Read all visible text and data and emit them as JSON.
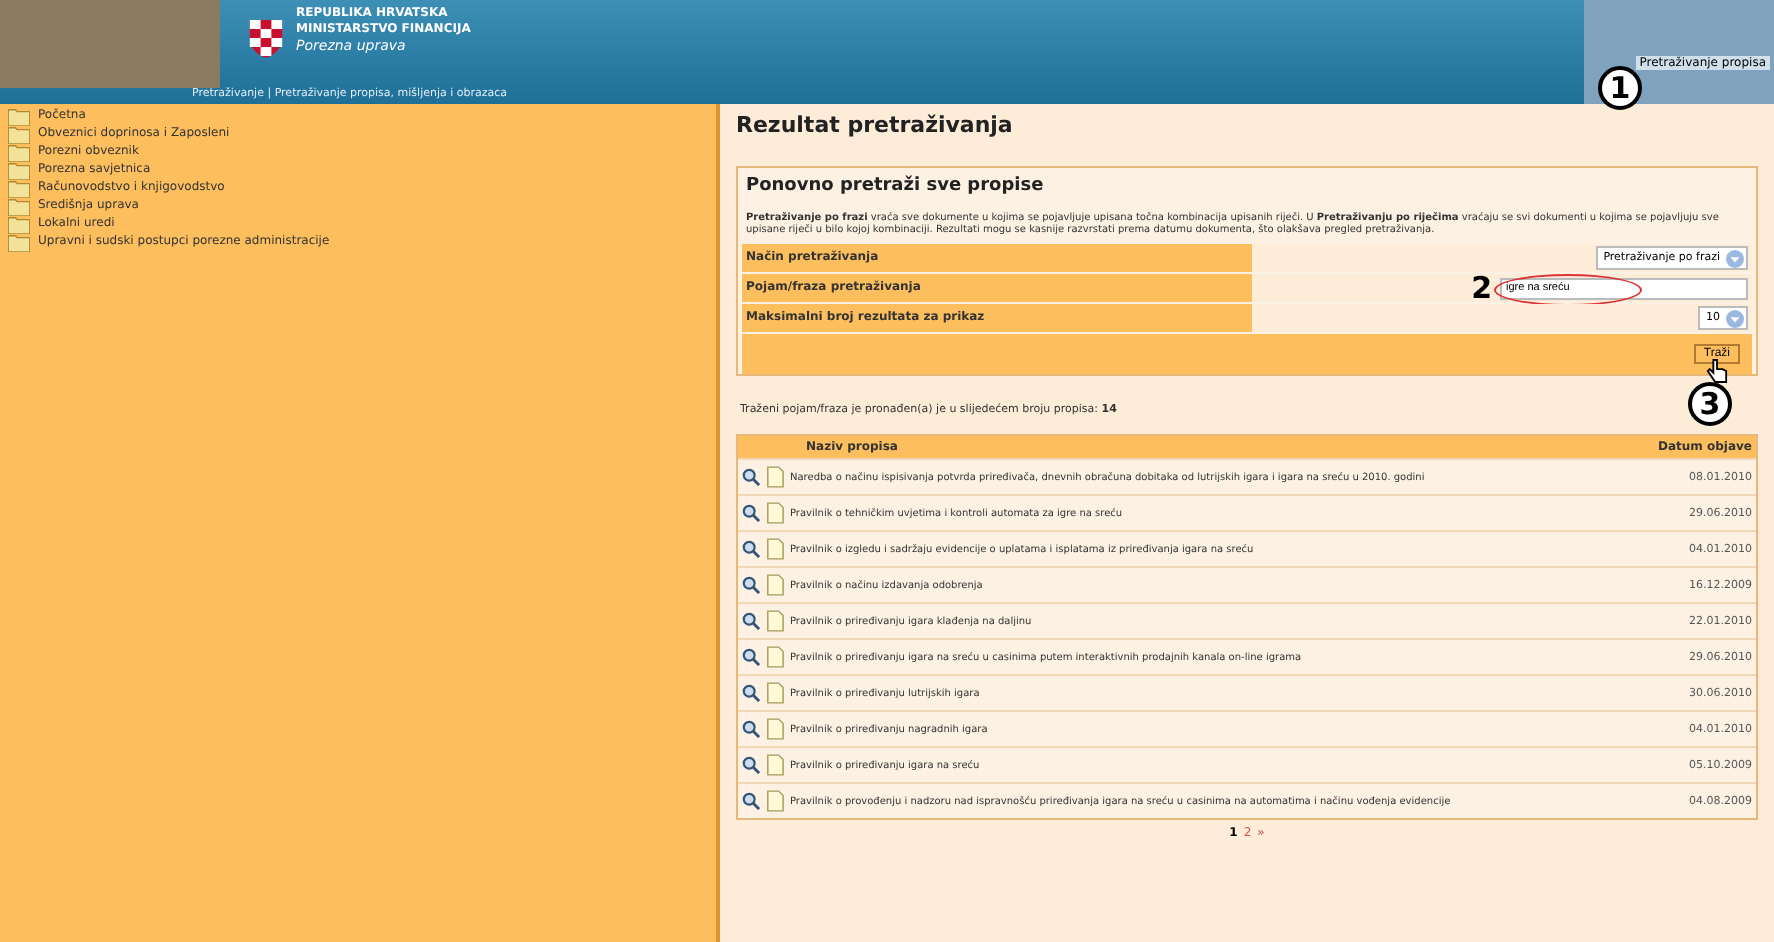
{
  "header": {
    "country": "REPUBLIKA HRVATSKA",
    "ministry": "MINISTARSTVO FINANCIJA",
    "agency": "Porezna uprava",
    "breadcrumb": "Pretraživanje | Pretraživanje propisa, mišljenja i obrazaca",
    "top_link": "Pretraživanje propisa"
  },
  "annotations": [
    "1",
    "2",
    "3"
  ],
  "sidebar": {
    "items": [
      {
        "label": "Početna"
      },
      {
        "label": "Obveznici doprinosa i Zaposleni"
      },
      {
        "label": "Porezni obveznik"
      },
      {
        "label": "Porezna savjetnica"
      },
      {
        "label": "Računovodstvo i knjigovodstvo"
      },
      {
        "label": "Središnja uprava"
      },
      {
        "label": "Lokalni uredi"
      },
      {
        "label": "Upravni i sudski postupci porezne administracije"
      }
    ]
  },
  "main": {
    "title": "Rezultat pretraživanja",
    "search_box": {
      "title": "Ponovno pretraži sve propise",
      "description": "**Pretraživanje po frazi** vraća sve dokumente u kojima se pojavljuje upisana točna kombinacija upisanih riječi. U **Pretraživanju po riječima** vraćaju se svi dokumenti u kojima se pojavljuju sve upisane riječi u bilo kojoj kombinaciji. Rezultati mogu se kasnije razvrstati prema datumu dokumenta, što olakšava pregled pretraživanja.",
      "fields": [
        {
          "kind": "select",
          "label": "Način pretraživanja",
          "value": "Pretraživanje po frazi"
        },
        {
          "kind": "input",
          "label": "Pojam/fraza pretraživanja",
          "value": "igre na sreću"
        },
        {
          "kind": "select",
          "label": "Maksimalni broj rezultata za prikaz",
          "value": "10"
        }
      ],
      "button": "Traži"
    },
    "result_count": "Traženi pojam/fraza je pronađen(a) je u slijedećem broju propisa: **14**",
    "table": {
      "columns": [
        "Naziv propisa",
        "Datum objave"
      ],
      "rows": [
        {
          "name": "Naredba o načinu ispisivanja potvrda priređivača, dnevnih obračuna dobitaka od lutrijskih igara i igara na sreću u 2010. godini",
          "date": "08.01.2010"
        },
        {
          "name": "Pravilnik o tehničkim uvjetima i kontroli automata za igre na sreću",
          "date": "29.06.2010"
        },
        {
          "name": "Pravilnik o izgledu i sadržaju evidencije o uplatama i isplatama iz priređivanja igara na sreću",
          "date": "04.01.2010"
        },
        {
          "name": "Pravilnik o načinu izdavanja odobrenja",
          "date": "16.12.2009"
        },
        {
          "name": "Pravilnik o priređivanju igara klađenja na daljinu",
          "date": "22.01.2010"
        },
        {
          "name": "Pravilnik o priređivanju igara na sreću u casinima putem interaktivnih prodajnih kanala on-line igrama",
          "date": "29.06.2010"
        },
        {
          "name": "Pravilnik o priređivanju lutrijskih igara",
          "date": "30.06.2010"
        },
        {
          "name": "Pravilnik o priređivanju nagradnih igara",
          "date": "04.01.2010"
        },
        {
          "name": "Pravilnik o priređivanju igara na sreću",
          "date": "05.10.2009"
        },
        {
          "name": "Pravilnik o provođenju i nadzoru nad ispravnošću priređivanja igara na sreću u casinima na automatima i načinu vođenja evidencije",
          "date": "04.08.2009"
        }
      ]
    },
    "pagination": [
      {
        "label": "1",
        "selected": true
      },
      {
        "label": "2",
        "selected": false
      },
      {
        "label": "»",
        "selected": false
      }
    ]
  }
}
